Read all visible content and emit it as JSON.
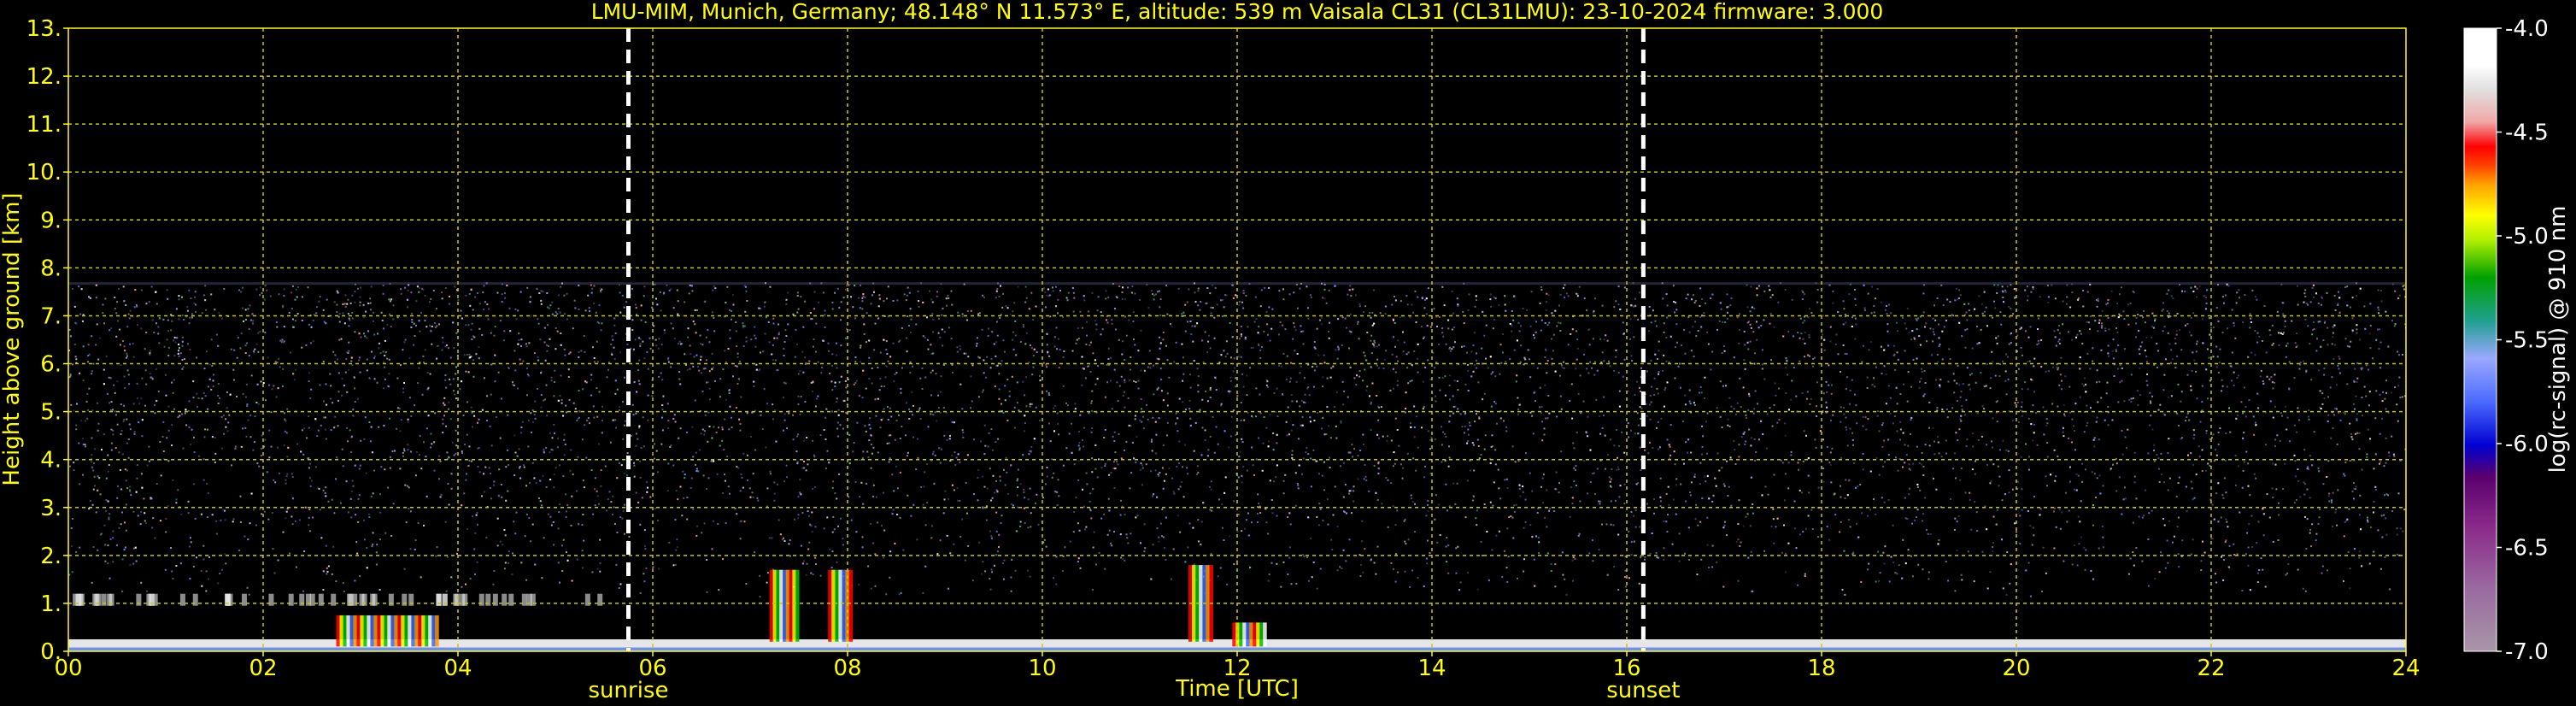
{
  "chart_data": {
    "type": "heatmap",
    "title": "LMU-MIM, Munich, Germany; 48.148° N 11.573° E, altitude: 539 m    Vaisala CL31 (CL31LMU): 23-10-2024    firmware: 3.000",
    "xlabel": "Time [UTC]",
    "ylabel": "Height above ground [km]",
    "xlim": [
      0,
      24
    ],
    "ylim": [
      0,
      13
    ],
    "x_ticks": [
      "00",
      "02",
      "04",
      "06",
      "08",
      "10",
      "12",
      "14",
      "16",
      "18",
      "20",
      "22",
      "24"
    ],
    "y_ticks": [
      "0.",
      "1.",
      "2.",
      "3.",
      "4.",
      "5.",
      "6.",
      "7.",
      "8.",
      "9.",
      "10.",
      "11.",
      "12.",
      "13."
    ],
    "grid": true,
    "events": [
      {
        "label": "sunrise",
        "time": 5.75
      },
      {
        "label": "sunset",
        "time": 16.17
      }
    ],
    "colorbar": {
      "label": "log(rc-signal) @ 910 nm",
      "range": [
        -7.0,
        -4.0
      ],
      "ticks": [
        "-4.0",
        "-4.5",
        "-5.0",
        "-5.5",
        "-6.0",
        "-6.5",
        "-7.0"
      ],
      "tick_values": [
        -4.0,
        -4.5,
        -5.0,
        -5.5,
        -6.0,
        -6.5,
        -7.0
      ]
    },
    "data_top_km": 7.7,
    "features": [
      {
        "kind": "surface_layer",
        "from": 0,
        "to": 24,
        "top_km": 0.25
      },
      {
        "kind": "cloud",
        "from": 2.75,
        "to": 3.8,
        "bottom_km": 0.1,
        "top_km": 0.75
      },
      {
        "kind": "aerosol_layer",
        "from": 0.0,
        "to": 5.5,
        "bottom_km": 0.95,
        "top_km": 1.2
      },
      {
        "kind": "cloud",
        "from": 7.2,
        "to": 7.5,
        "bottom_km": 0.2,
        "top_km": 1.7
      },
      {
        "kind": "cloud",
        "from": 7.8,
        "to": 8.05,
        "bottom_km": 0.2,
        "top_km": 1.7
      },
      {
        "kind": "cloud",
        "from": 11.5,
        "to": 11.75,
        "bottom_km": 0.2,
        "top_km": 1.8
      },
      {
        "kind": "cloud",
        "from": 11.95,
        "to": 12.3,
        "bottom_km": 0.1,
        "top_km": 0.6
      }
    ],
    "colors": {
      "background": "#000000",
      "text": "#ffff00",
      "grid": "#c8c800",
      "event_line": "#ffffff"
    }
  }
}
